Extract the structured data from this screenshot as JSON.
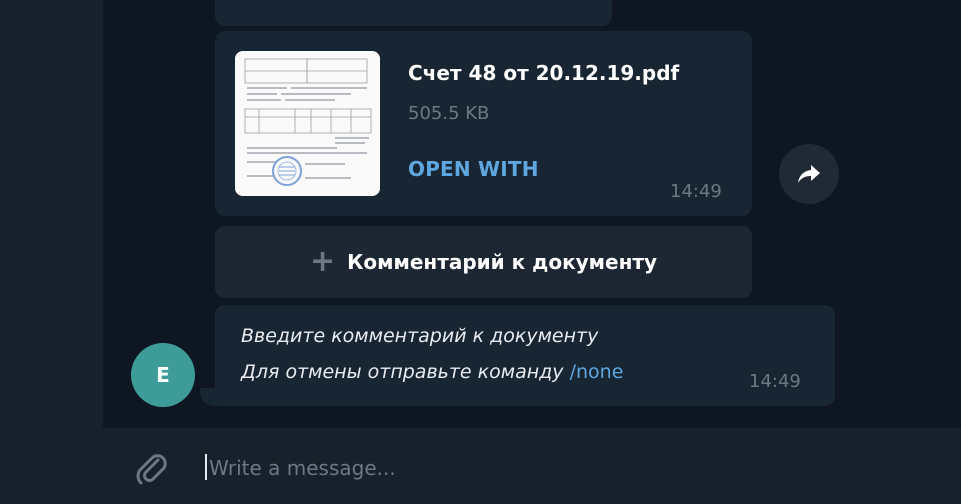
{
  "messages": {
    "file": {
      "name": "Счет  48 от 20.12.19.pdf",
      "size": "505.5 KB",
      "action": "OPEN WITH",
      "time": "14:49"
    },
    "keyboard_button": {
      "label": "Комментарий к документу"
    },
    "bot_text": {
      "line1": "Введите комментарий к документу",
      "line2_prefix": "Для отмены отправьте команду ",
      "command": "/none",
      "time": "14:49"
    },
    "avatar_letter": "E"
  },
  "composer": {
    "placeholder": "Write a message..."
  },
  "colors": {
    "background": "#0e1621",
    "panel": "#17212b",
    "bubble": "#182533",
    "accent": "#5fa7e0",
    "muted": "#6c7883",
    "avatar": "#3d9c98"
  },
  "icons": [
    "forward-icon",
    "plus-icon",
    "attach-paperclip-icon",
    "pdf-thumbnail"
  ]
}
